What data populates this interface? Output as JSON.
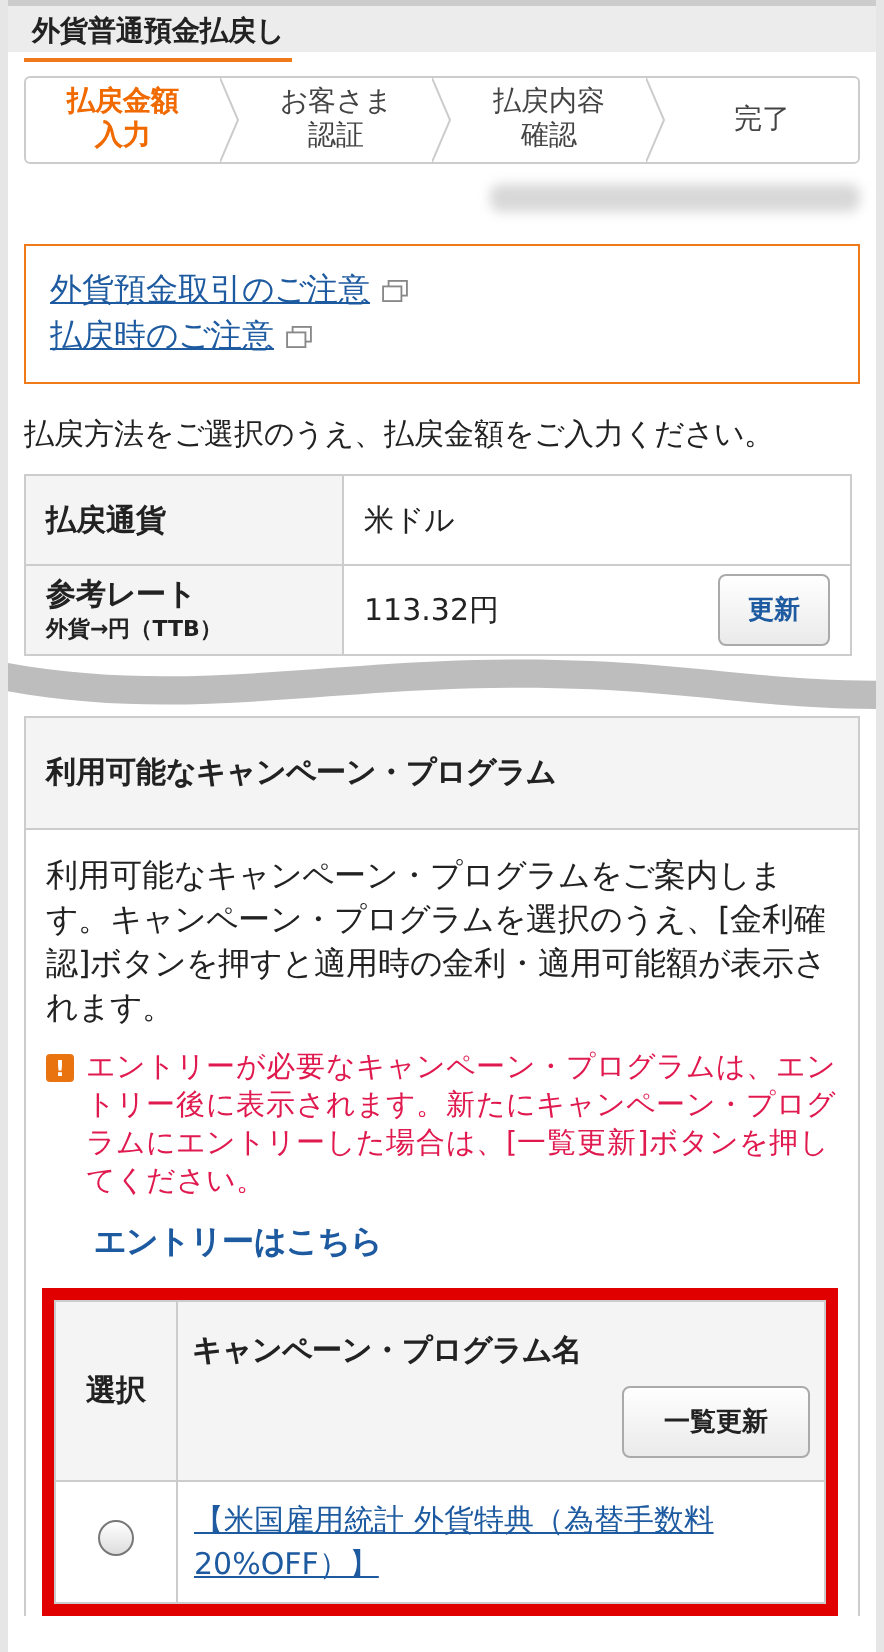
{
  "header": {
    "title": "外貨普通預金払戻し"
  },
  "steps": [
    {
      "lines": [
        "払戻金額",
        "入力"
      ],
      "selected": true
    },
    {
      "lines": [
        "お客さま",
        "認証"
      ],
      "selected": false
    },
    {
      "lines": [
        "払戻内容",
        "確認"
      ],
      "selected": false
    },
    {
      "lines": [
        "完了"
      ],
      "selected": false
    }
  ],
  "notices": [
    {
      "label": "外貨預金取引のご注意"
    },
    {
      "label": "払戻時のご注意"
    }
  ],
  "instruction": "払戻方法をご選択のうえ、払戻金額をご入力ください。",
  "summary": {
    "currency_label": "払戻通貨",
    "currency_value": "米ドル",
    "rate_label": "参考レート",
    "rate_sublabel": "外貨→円（TTB）",
    "rate_value": "113.32円",
    "refresh_button": "更新"
  },
  "campaign": {
    "heading": "利用可能なキャンペーン・プログラム",
    "description": "利用可能なキャンペーン・プログラムをご案内します。キャンペーン・プログラムを選択のうえ、[金利確認]ボタンを押すと適用時の金利・適用可能額が表示されます。",
    "warning": "エントリーが必要なキャンペーン・プログラムは、エントリー後に表示されます。新たにキャンペーン・プログラムにエントリーした場合は、[一覧更新]ボタンを押してください。",
    "warning_icon": "!",
    "entry_link": "エントリーはこちら",
    "table": {
      "columns": [
        "選択",
        "キャンペーン・プログラム名"
      ],
      "refresh_button": "一覧更新",
      "rows": [
        {
          "name": "【米国雇用統計 外貨特典（為替手数料20%OFF）】",
          "selected": false
        }
      ]
    }
  }
}
